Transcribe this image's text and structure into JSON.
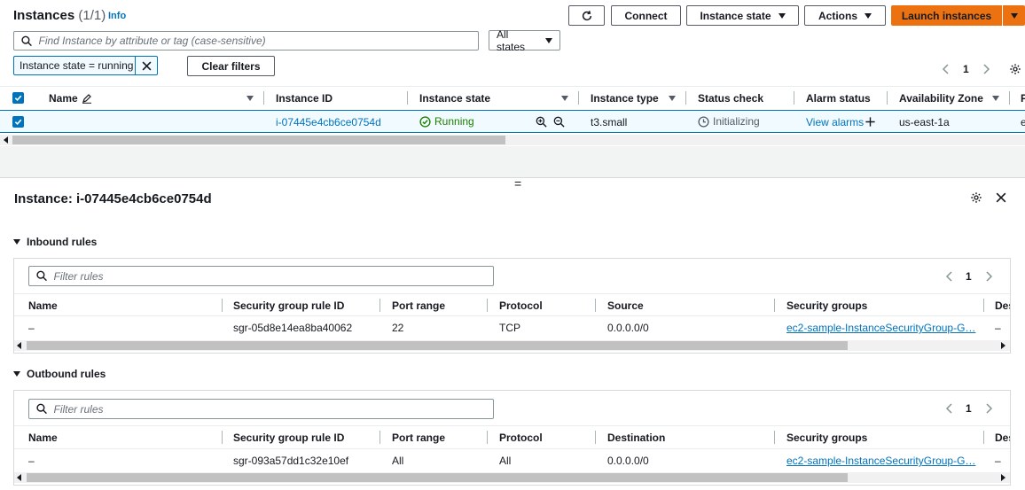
{
  "header": {
    "title": "Instances",
    "count": "(1/1)",
    "info": "Info",
    "connect": "Connect",
    "instance_state": "Instance state",
    "actions": "Actions",
    "launch": "Launch instances"
  },
  "search": {
    "placeholder": "Find Instance by attribute or tag (case-sensitive)",
    "states_select": "All states"
  },
  "filter": {
    "chip": "Instance state = running",
    "clear": "Clear filters"
  },
  "pager": {
    "page": "1"
  },
  "table": {
    "columns": [
      "Name",
      "Instance ID",
      "Instance state",
      "Instance type",
      "Status check",
      "Alarm status",
      "Availability Zone",
      "F"
    ],
    "row": {
      "name": "",
      "instance_id": "i-07445e4cb6ce0754d",
      "state": "Running",
      "type": "t3.small",
      "status_check": "Initializing",
      "alarm": "View alarms",
      "az": "us-east-1a",
      "extra": "e"
    }
  },
  "splitter": "=",
  "detail": {
    "title": "Instance: i-07445e4cb6ce0754d",
    "inbound": {
      "heading": "Inbound rules",
      "filter_placeholder": "Filter rules",
      "page": "1",
      "columns": [
        "Name",
        "Security group rule ID",
        "Port range",
        "Protocol",
        "Source",
        "Security groups",
        "Des"
      ],
      "row": {
        "name": "–",
        "rule_id": "sgr-05d8e14ea8ba40062",
        "port": "22",
        "protocol": "TCP",
        "source": "0.0.0.0/0",
        "sg": "ec2-sample-InstanceSecurityGroup-G…",
        "desc": "–"
      }
    },
    "outbound": {
      "heading": "Outbound rules",
      "filter_placeholder": "Filter rules",
      "page": "1",
      "columns": [
        "Name",
        "Security group rule ID",
        "Port range",
        "Protocol",
        "Destination",
        "Security groups",
        "Des"
      ],
      "row": {
        "name": "–",
        "rule_id": "sgr-093a57dd1c32e10ef",
        "port": "All",
        "protocol": "All",
        "dest": "0.0.0.0/0",
        "sg": "ec2-sample-InstanceSecurityGroup-G…",
        "desc": "–"
      }
    }
  },
  "colors": {
    "primary": "#ec7211",
    "link": "#0073bb",
    "running": "#1d8102",
    "border": "#aab7b8"
  }
}
